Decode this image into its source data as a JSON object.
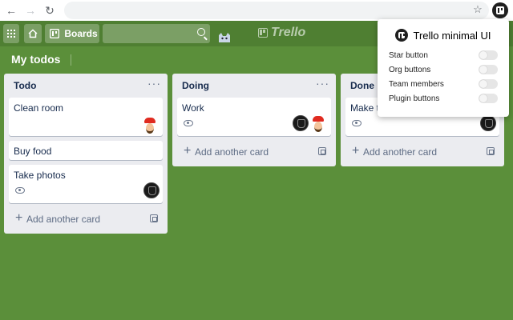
{
  "browser": {
    "back_icon": "arrow-left-icon",
    "forward_icon": "arrow-right-icon",
    "reload_icon": "reload-icon",
    "star_icon": "star-icon",
    "extension_icon": "trello-icon"
  },
  "header": {
    "boards_label": "Boards",
    "logo_text": "Trello"
  },
  "board": {
    "title": "My todos",
    "lists": [
      {
        "title": "Todo",
        "cards": [
          "Clean room",
          "Buy food",
          "Take photos"
        ],
        "add_label": "Add another card"
      },
      {
        "title": "Doing",
        "cards": [
          "Work"
        ],
        "add_label": "Add another card"
      },
      {
        "title": "Done",
        "cards": [
          "Make te"
        ],
        "add_label": "Add another card"
      }
    ]
  },
  "popup": {
    "title": "Trello minimal UI",
    "options": [
      "Star button",
      "Org buttons",
      "Team members",
      "Plugin buttons"
    ]
  }
}
